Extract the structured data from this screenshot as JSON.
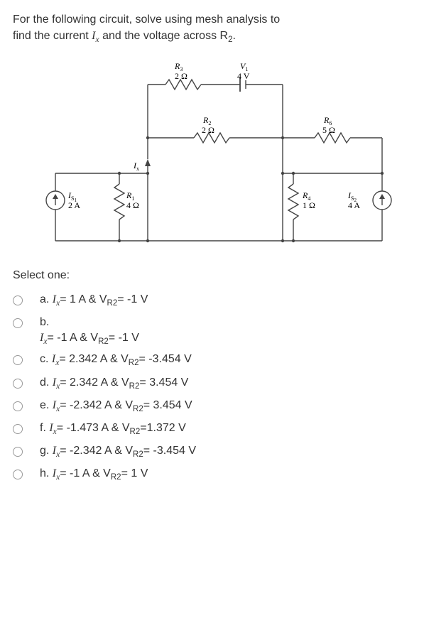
{
  "question": {
    "line1_pre": "For the following circuit, solve using mesh analysis to",
    "line2_pre": "find the current ",
    "ix_var": "I",
    "ix_sub": "x",
    "line2_mid": " and the voltage across R",
    "r2_sub": "2",
    "line2_end": "."
  },
  "circuit": {
    "R3_name": "R",
    "R3_sub": "3",
    "R3_val": "2 Ω",
    "V1_name": "V",
    "V1_sub": "1",
    "V1_val": "4 V",
    "R2_name": "R",
    "R2_sub": "2",
    "R2_val": "2 Ω",
    "R6_name": "R",
    "R6_sub": "6",
    "R6_val": "5 Ω",
    "Ix_name": "I",
    "Ix_sub": "x",
    "Is1_name": "I",
    "Is1_sub": "S",
    "Is1_sub2": "1",
    "Is1_val": "2 A",
    "R1_name": "R",
    "R1_sub": "1",
    "R1_val": "4 Ω",
    "R4_name": "R",
    "R4_sub": "4",
    "R4_val": "1 Ω",
    "Is2_name": "I",
    "Is2_sub": "S",
    "Is2_sub2": "2",
    "Is2_val": "4 A"
  },
  "select_label": "Select one:",
  "options": {
    "a": {
      "letter": "a. ",
      "pre": "I",
      "sub": "x",
      "mid": "= 1 A & V",
      "sub2": "R2",
      "end": "= -1 V"
    },
    "b": {
      "letter": "b.",
      "cont_pre": "I",
      "cont_sub": "x",
      "cont_mid": "= -1 A & V",
      "cont_sub2": "R2",
      "cont_end": "= -1 V"
    },
    "c": {
      "letter": "c. ",
      "pre": "I",
      "sub": "x",
      "mid": "= 2.342 A & V",
      "sub2": "R2",
      "end": "= -3.454 V"
    },
    "d": {
      "letter": "d. ",
      "pre": "I",
      "sub": "x",
      "mid": "= 2.342 A & V",
      "sub2": "R2",
      "end": "= 3.454 V"
    },
    "e": {
      "letter": "e. ",
      "pre": "I",
      "sub": "x",
      "mid": "= -2.342 A & V",
      "sub2": "R2",
      "end": "= 3.454 V"
    },
    "f": {
      "letter": "f. ",
      "pre": "I",
      "sub": "x",
      "mid": "= -1.473 A & V",
      "sub2": "R2",
      "end": "=1.372 V"
    },
    "g": {
      "letter": "g. ",
      "pre": "I",
      "sub": "x",
      "mid": "= -2.342 A & V",
      "sub2": "R2",
      "end": "= -3.454 V"
    },
    "h": {
      "letter": "h. ",
      "pre": "I",
      "sub": "x",
      "mid": "= -1 A & V",
      "sub2": "R2",
      "end": "= 1 V"
    }
  }
}
